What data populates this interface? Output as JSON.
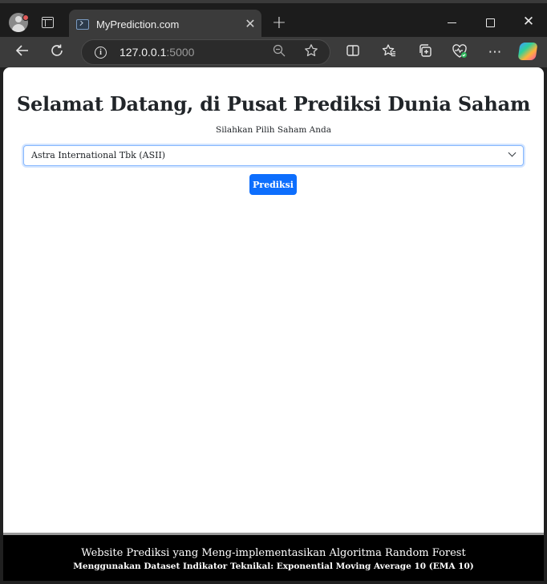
{
  "browser": {
    "tab_title": "MyPrediction.com",
    "url_host": "127.0.0.1",
    "url_port": ":5000",
    "icons": {
      "profile": "profile-avatar-icon",
      "tab_actions": "tab-actions-icon",
      "favicon": "terminal-favicon-icon",
      "tab_close": "close-icon",
      "new_tab": "plus-icon",
      "back": "back-arrow-icon",
      "refresh": "refresh-icon",
      "site_info": "info-icon",
      "zoom": "zoom-out-icon",
      "favorite": "star-icon",
      "split_screen": "split-screen-icon",
      "favorites": "favorites-icon",
      "collections": "collections-icon",
      "browser_essentials": "heart-pulse-icon",
      "more": "more-icon",
      "copilot": "copilot-icon"
    }
  },
  "page": {
    "title": "Selamat Datang, di Pusat Prediksi Dunia Saham",
    "subtitle": "Silahkan Pilih Saham Anda",
    "select_value": "Astra International Tbk (ASII)",
    "predict_button": "Prediksi",
    "footer_line1": "Website Prediksi yang Meng-implementasikan Algoritma Random Forest",
    "footer_line2": "Menggunakan Dataset Indikator Teknikal: Exponential Moving Average 10 (EMA 10)"
  },
  "colors": {
    "primary": "#0d6efd",
    "footer_bg": "#000000",
    "chrome_bg": "#3b3b3b"
  }
}
